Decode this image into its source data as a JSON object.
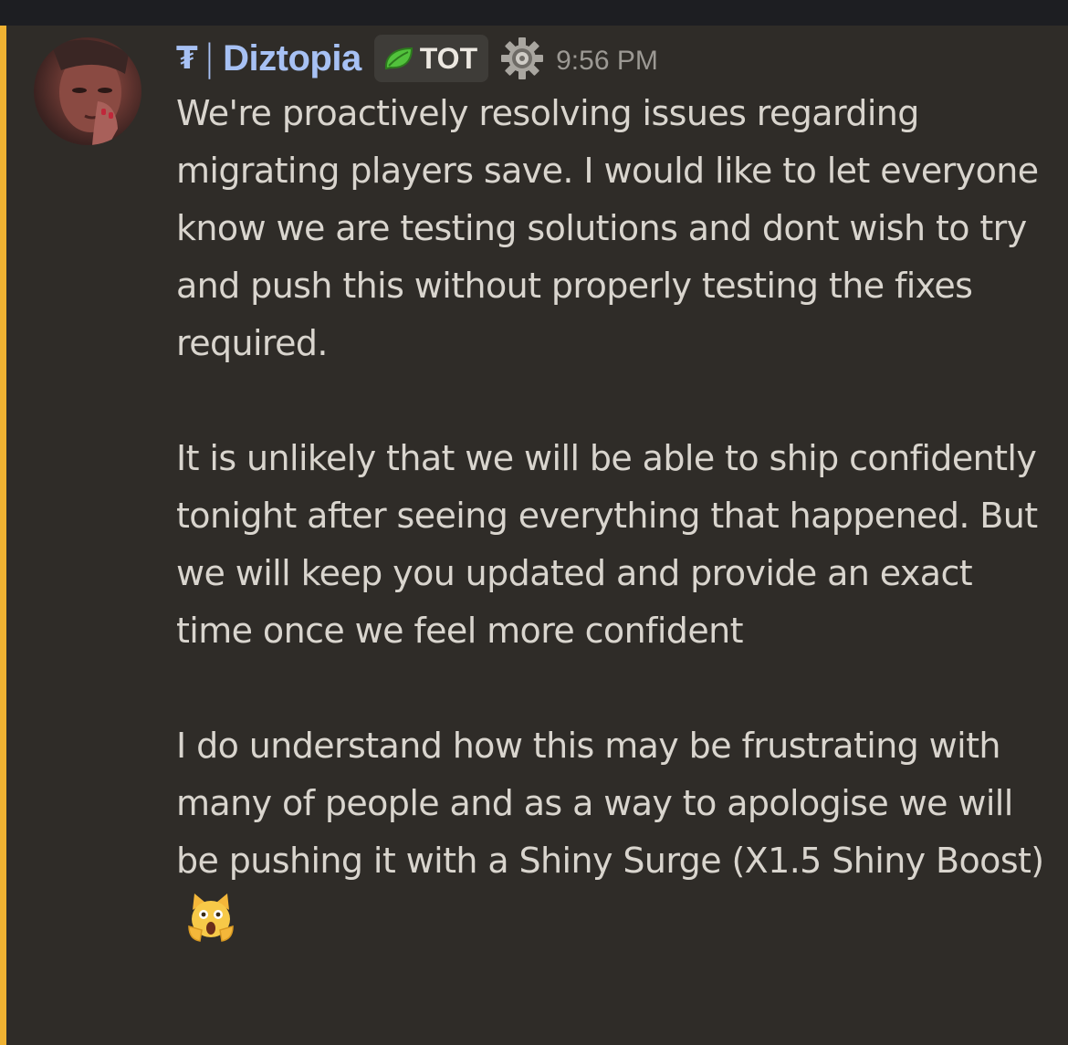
{
  "message": {
    "author": {
      "guild_tag_glyph": "₮",
      "separator": "|",
      "name": "Diztopia",
      "name_color": "#a7c1f4",
      "avatar_icon": "avatar"
    },
    "role_tag": {
      "icon": "leaf-icon",
      "label": "TOT"
    },
    "badge_icon": "gear-icon",
    "timestamp": "9:56 PM",
    "paragraphs": [
      "We're proactively resolving issues regarding migrating players save. I would like to let everyone know we are testing solutions and dont wish to try and push this without properly testing the fixes required.",
      "It is unlikely that we will be able to ship confidently tonight after seeing everything that happened. But we will keep you updated and provide an exact time once we feel more confident",
      "I do understand how this may be frustrating with many of people and as a way to apologise we will be pushing it with a Shiny Surge (X1.5 Shiny Boost)"
    ],
    "trailing_emoji": "scream-cat-emoji",
    "highlight_color": "#f0b232"
  }
}
